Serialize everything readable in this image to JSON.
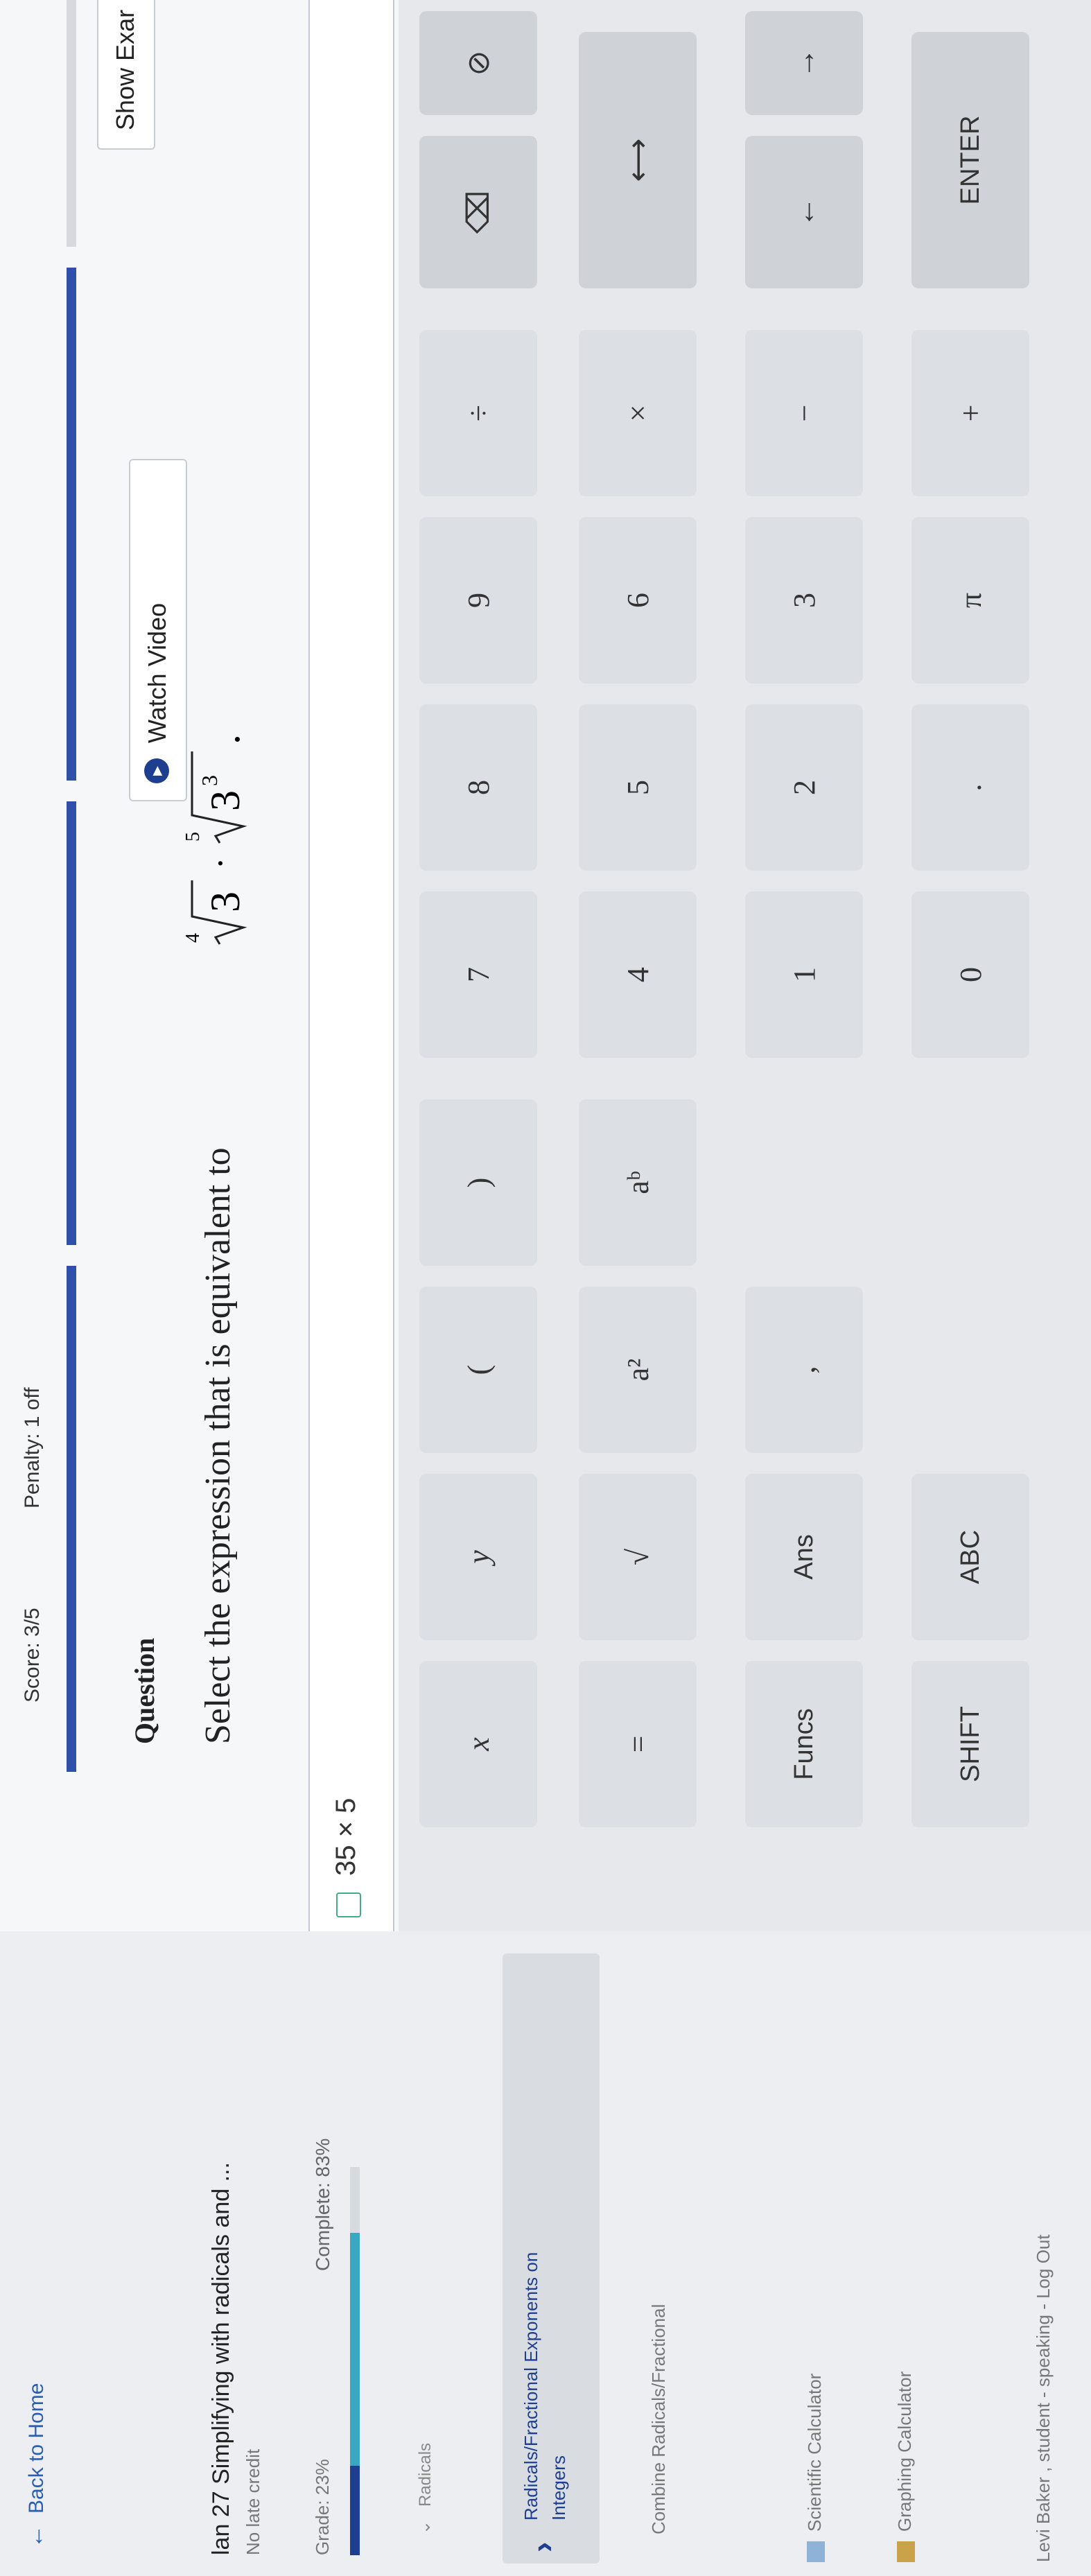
{
  "sidebar": {
    "back_label": "Back to Home",
    "assignment_title": "lan 27 Simplifying with radicals and ...",
    "late_credit": "No late credit",
    "grade_label": "Grade: 23%",
    "grade_fraction": 0.23,
    "complete_label": "Complete: 83%",
    "complete_fraction": 0.83,
    "topic_parent": "Radicals",
    "active_topic_line1": "Radicals/Fractional Exponents on",
    "active_topic_line2": "Integers",
    "topic_next": "Combine Radicals/Fractional",
    "tools": [
      "Scientific Calculator",
      "Graphing Calculator"
    ],
    "footer": "Levi Baker , student - speaking - Log Out"
  },
  "header": {
    "score": "Score: 3/5",
    "penalty": "Penalty: 1 off"
  },
  "buttons": {
    "watch_video": "Watch Video",
    "show_example": "Show Exar"
  },
  "question": {
    "heading": "Question",
    "prompt": "Select the expression that is equivalent to",
    "math": {
      "radicand1": "3",
      "index1": "4",
      "radicand2": "3",
      "exponent2": "3",
      "index2": "5"
    }
  },
  "answer": {
    "value": "35 × 5"
  },
  "keypad": {
    "rows": [
      [
        "x",
        "y",
        "(",
        ")",
        "7",
        "8",
        "9",
        "÷",
        "⌫",
        "⊘"
      ],
      [
        "=",
        "√",
        "a²",
        "aᵇ",
        "4",
        "5",
        "6",
        "×",
        "⟷",
        ""
      ],
      [
        "Funcs",
        "Ans",
        ",",
        "",
        "1",
        "2",
        "3",
        "−",
        "←",
        "→"
      ],
      [
        "SHIFT",
        "ABC",
        "",
        "",
        "0",
        ".",
        "π",
        "+",
        "ENTER",
        ""
      ]
    ]
  }
}
